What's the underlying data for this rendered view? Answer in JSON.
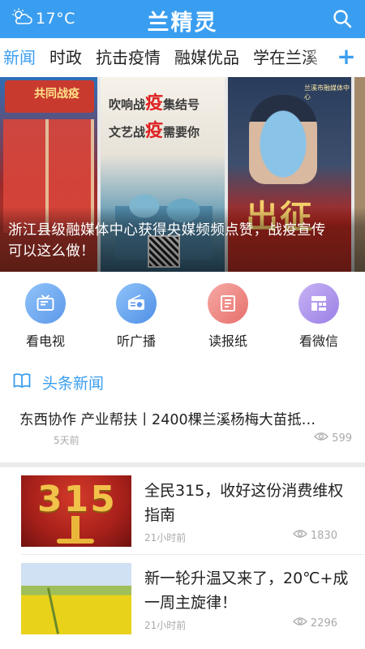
{
  "header": {
    "temperature": "17°C",
    "weather_icon": "partly-cloudy-icon",
    "title": "兰精灵",
    "search_icon": "search-icon"
  },
  "tabs": [
    {
      "label": "新闻",
      "active": true
    },
    {
      "label": "时政",
      "active": false
    },
    {
      "label": "抗击疫情",
      "active": false
    },
    {
      "label": "融媒优品",
      "active": false
    },
    {
      "label": "学在兰溪",
      "active": false
    }
  ],
  "tab_add_label": "+",
  "carousel": {
    "caption": "浙江县级融媒体中心获得央媒频频点赞，战疫宣传可以这么做！",
    "dot_count": 5,
    "active_dot": 0,
    "slide1_banner": "共同战疫",
    "slide2_lines": [
      {
        "pre": "吹响战",
        "hl": "疫",
        "post": "集结号"
      },
      {
        "pre": "文艺战",
        "hl": "疫",
        "post": "需要你"
      }
    ],
    "slide3_big": "出征",
    "slide3_top": "兰溪市融媒体中心"
  },
  "quick_entries": [
    {
      "label": "看电视",
      "icon": "tv-icon"
    },
    {
      "label": "听广播",
      "icon": "radio-icon"
    },
    {
      "label": "读报纸",
      "icon": "newspaper-icon"
    },
    {
      "label": "看微信",
      "icon": "grid-icon"
    }
  ],
  "headline_section": {
    "title": "头条新闻",
    "icon": "book-icon"
  },
  "top_news": {
    "title": "东西协作 产业帮扶丨2400棵兰溪杨梅大苗抵…",
    "time": "5天前",
    "views": "599"
  },
  "news": [
    {
      "title": "全民315，收好这份消费维权指南",
      "time": "21小时前",
      "views": "1830",
      "thumb_text": "315"
    },
    {
      "title": "新一轮升温又来了，20℃+成一周主旋律！",
      "time": "21小时前",
      "views": "2296"
    }
  ],
  "colors": {
    "primary": "#3a9ef0",
    "divider": "#ececec",
    "meta": "#aaaaaa"
  }
}
